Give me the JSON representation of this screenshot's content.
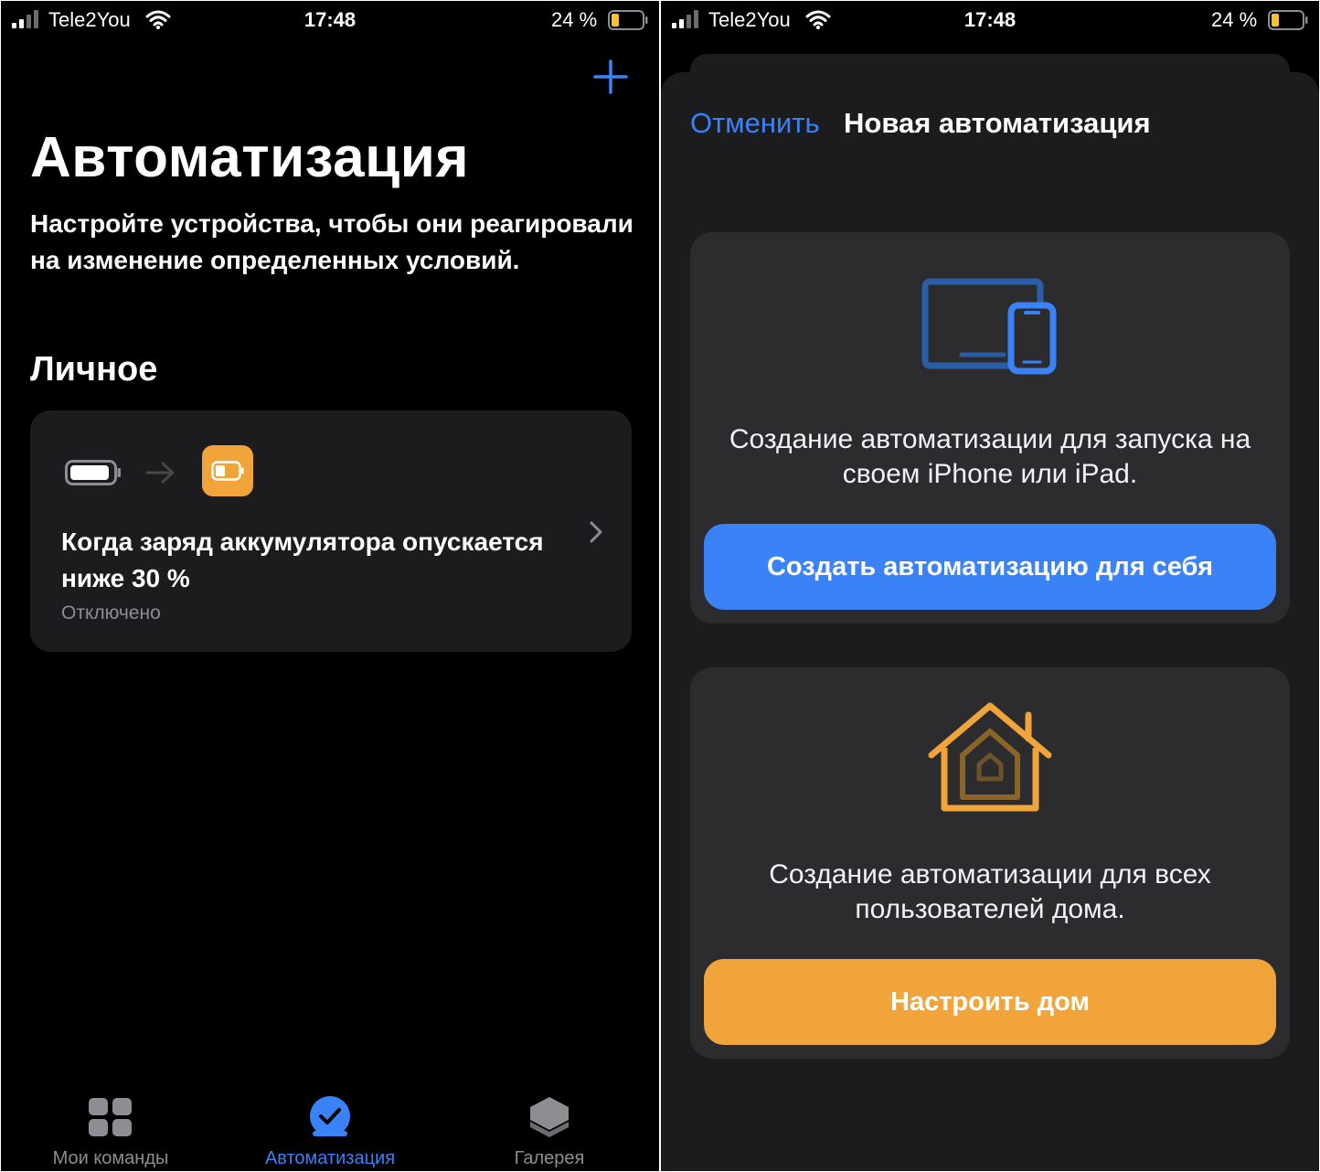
{
  "status_bar": {
    "carrier": "Tele2You",
    "time": "17:48",
    "battery_percent": "24 %"
  },
  "left_screen": {
    "title": "Автоматизация",
    "subtitle": "Настройте устройства, чтобы они реагировали на изменение определенных условий.",
    "section_title": "Личное",
    "automation": {
      "title": "Когда заряд аккумулятора опускается ниже 30 %",
      "status": "Отключено"
    },
    "tabs": [
      {
        "label": "Мои команды",
        "icon": "grid-icon",
        "active": false
      },
      {
        "label": "Автоматизация",
        "icon": "clock-check-icon",
        "active": true
      },
      {
        "label": "Галерея",
        "icon": "layers-icon",
        "active": false
      }
    ]
  },
  "right_screen": {
    "cancel_label": "Отменить",
    "sheet_title": "Новая автоматизация",
    "options": [
      {
        "icon": "devices-icon",
        "description": "Создание автоматизации для запуска на своем iPhone или iPad.",
        "button_label": "Создать автоматизацию для себя"
      },
      {
        "icon": "home-icon",
        "description": "Создание автоматизации для всех пользователей дома.",
        "button_label": "Настроить дом"
      }
    ]
  },
  "colors": {
    "accent_blue": "#3a82f7",
    "accent_orange": "#f0a43a",
    "card_bg": "#1c1c1e",
    "secondary_text": "#8d8d93"
  }
}
